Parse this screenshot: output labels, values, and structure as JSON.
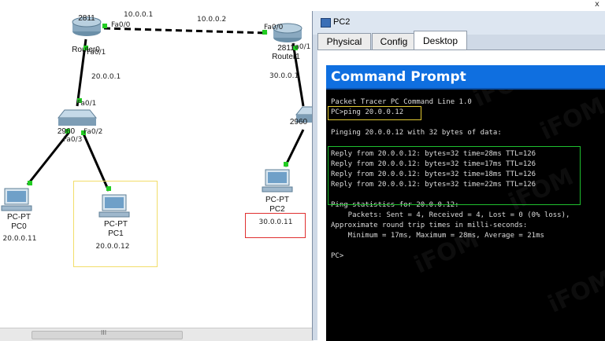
{
  "topology": {
    "devices": {
      "router0": {
        "name_a": "2811",
        "name_b": "Router0"
      },
      "router1": {
        "name_a": "2811",
        "name_b": "Router1"
      },
      "switch0": {
        "name": "2960"
      },
      "switch1": {
        "name": "2960"
      },
      "pc0": {
        "type": "PC-PT",
        "name": "PC0",
        "ip": "20.0.0.11"
      },
      "pc1": {
        "type": "PC-PT",
        "name": "PC1",
        "ip": "20.0.0.12"
      },
      "pc2": {
        "type": "PC-PT",
        "name": "PC2",
        "ip": "30.0.0.11"
      }
    },
    "labels": {
      "r0_fa00": "Fa0/0",
      "r0_fa01": "Fa0/1",
      "r1_fa00": "Fa0/0",
      "r1_fa01": "Fa0/1",
      "wan_left_ip": "10.0.0.1",
      "wan_right_ip": "10.0.0.2",
      "lan0_gw": "20.0.0.1",
      "lan1_gw": "30.0.0.1",
      "sw_fa01": "Fa0/1",
      "sw_fa02": "Fa0/2",
      "sw_fa03": "Fa0/3"
    },
    "colors": {
      "link": "#000000",
      "link_dot": "#22cc22",
      "highlight_pc1": "#f2dd6a",
      "highlight_pc2": "#e03030"
    }
  },
  "pc2_window": {
    "title": "PC2",
    "tabs": [
      "Physical",
      "Config",
      "Desktop"
    ],
    "active_tab": "Desktop",
    "close_glyph": "x"
  },
  "command_prompt": {
    "title": "Command Prompt",
    "lines": [
      "Packet Tracer PC Command Line 1.0",
      "PC>ping 20.0.0.12",
      "",
      "Pinging 20.0.0.12 with 32 bytes of data:",
      "",
      "Reply from 20.0.0.12: bytes=32 time=28ms TTL=126",
      "Reply from 20.0.0.12: bytes=32 time=17ms TTL=126",
      "Reply from 20.0.0.12: bytes=32 time=18ms TTL=126",
      "Reply from 20.0.0.12: bytes=32 time=22ms TTL=126",
      "",
      "Ping statistics for 20.0.0.12:",
      "    Packets: Sent = 4, Received = 4, Lost = 0 (0% loss),",
      "Approximate round trip times in milli-seconds:",
      "    Minimum = 17ms, Maximum = 28ms, Average = 21ms",
      "",
      "PC>"
    ],
    "colors": {
      "header": "#0f6fe0",
      "background": "#000000",
      "text": "#dcdcdc",
      "reply_box": "#1fbf2f",
      "command_box": "#e2c933"
    }
  },
  "watermark": {
    "text": "iFOM"
  },
  "scrollbar": {
    "grip": "III"
  }
}
